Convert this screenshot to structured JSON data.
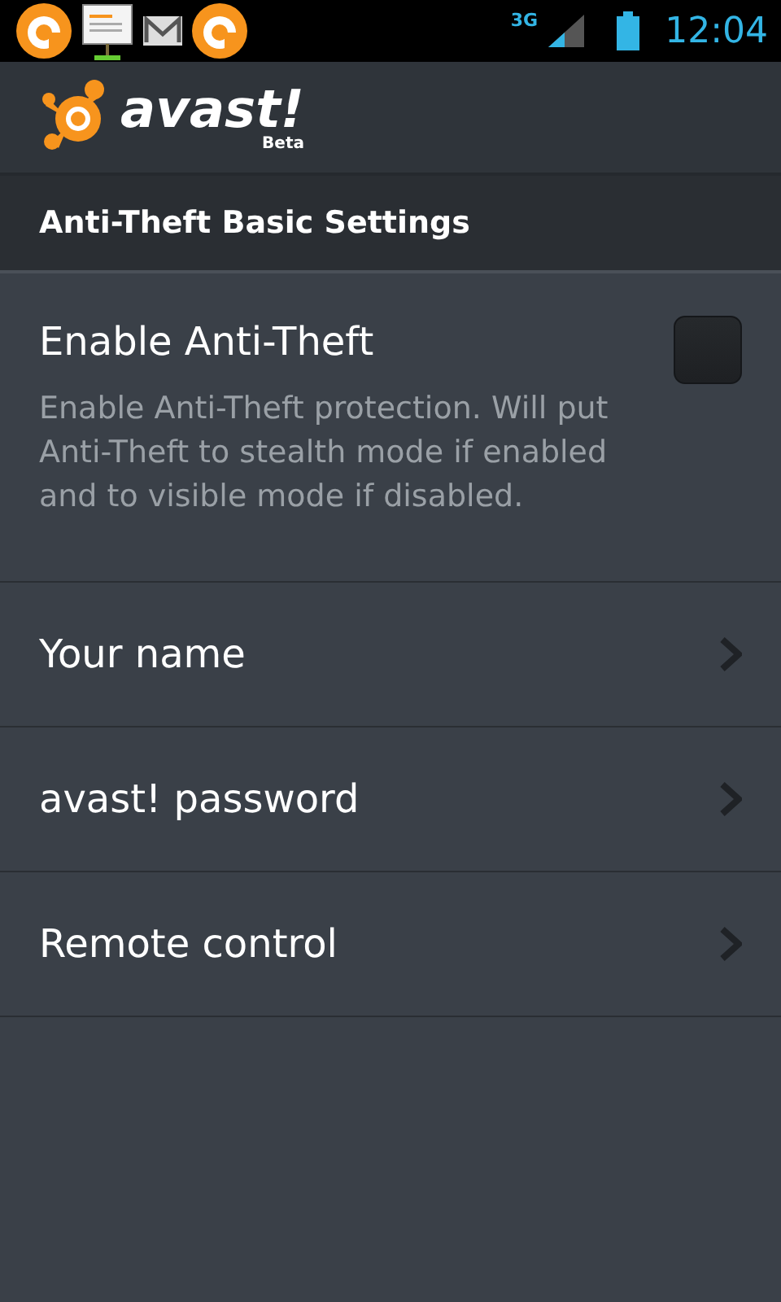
{
  "status_bar": {
    "network": "3G",
    "time": "12:04"
  },
  "app_bar": {
    "logo_text": "avast!",
    "badge": "Beta"
  },
  "section_title": "Anti-Theft Basic Settings",
  "settings": [
    {
      "kind": "checkbox",
      "title": "Enable Anti-Theft",
      "summary": "Enable Anti-Theft protection. Will put Anti-Theft to stealth mode if enabled and to visible mode if disabled.",
      "checked": false
    },
    {
      "kind": "link",
      "title": "Your name"
    },
    {
      "kind": "link",
      "title": "avast! password"
    },
    {
      "kind": "link",
      "title": "Remote control"
    }
  ]
}
